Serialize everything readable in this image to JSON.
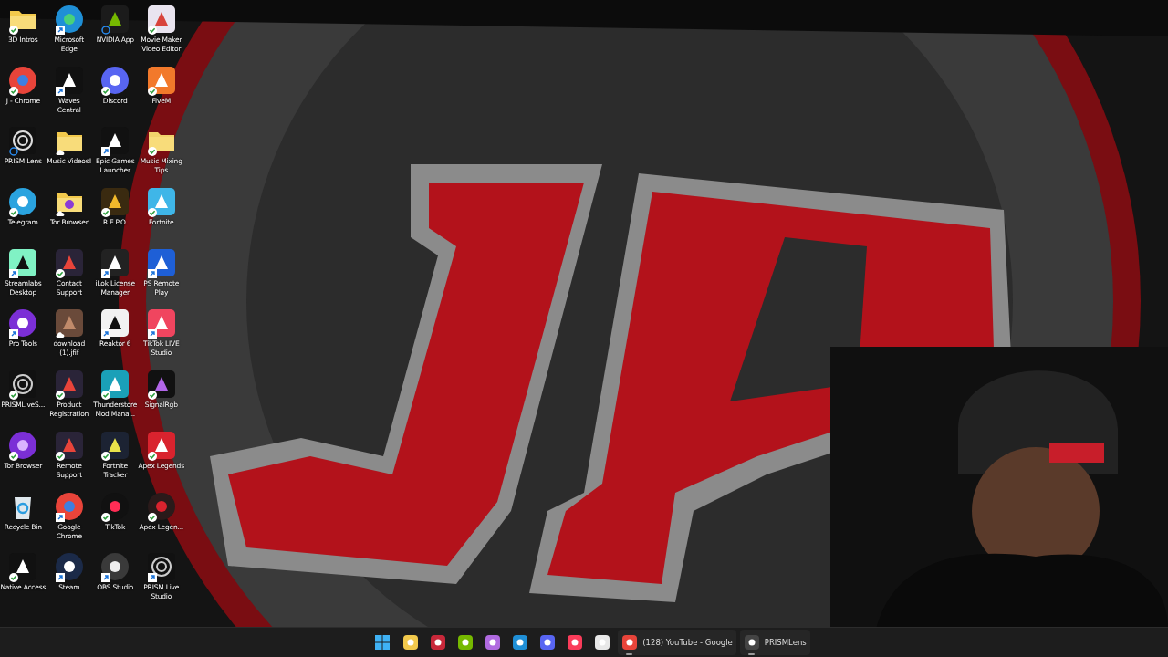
{
  "desktop_icons": [
    {
      "label": "3D Intros",
      "kind": "synced"
    },
    {
      "label": "Microsoft Edge",
      "kind": "shortcut"
    },
    {
      "label": "NVIDIA App",
      "kind": "syncing"
    },
    {
      "label": "Movie Maker Video Editor",
      "kind": "synced"
    },
    {
      "label": "J - Chrome",
      "kind": "synced"
    },
    {
      "label": "Waves Central",
      "kind": "shortcut"
    },
    {
      "label": "Discord",
      "kind": "synced"
    },
    {
      "label": "FiveM",
      "kind": "synced"
    },
    {
      "label": "PRISM Lens",
      "kind": "syncing"
    },
    {
      "label": "Music Videos!",
      "kind": "cloud"
    },
    {
      "label": "Epic Games Launcher",
      "kind": "shortcut"
    },
    {
      "label": "Music Mixing Tips",
      "kind": "synced"
    },
    {
      "label": "Telegram",
      "kind": "synced"
    },
    {
      "label": "Tor Browser",
      "kind": "cloud"
    },
    {
      "label": "R.E.P.O.",
      "kind": "synced"
    },
    {
      "label": "Fortnite",
      "kind": "synced"
    },
    {
      "label": "Streamlabs Desktop",
      "kind": "shortcut"
    },
    {
      "label": "Contact Support",
      "kind": "synced"
    },
    {
      "label": "iLok License Manager",
      "kind": "shortcut"
    },
    {
      "label": "PS Remote Play",
      "kind": "shortcut"
    },
    {
      "label": "Pro Tools",
      "kind": "shortcut"
    },
    {
      "label": "download (1).jfif",
      "kind": "cloud"
    },
    {
      "label": "Reaktor 6",
      "kind": "shortcut"
    },
    {
      "label": "TikTok LIVE Studio",
      "kind": "shortcut"
    },
    {
      "label": "PRISMLiveS...",
      "kind": "synced"
    },
    {
      "label": "Product Registration",
      "kind": "synced"
    },
    {
      "label": "Thunderstore Mod Mana...",
      "kind": "synced"
    },
    {
      "label": "SignalRgb",
      "kind": "synced"
    },
    {
      "label": "Tor Browser",
      "kind": "synced"
    },
    {
      "label": "Remote Support",
      "kind": "synced"
    },
    {
      "label": "Fortnite Tracker",
      "kind": "synced"
    },
    {
      "label": "Apex Legends",
      "kind": "synced"
    },
    {
      "label": "Recycle Bin",
      "kind": "plain"
    },
    {
      "label": "Google Chrome",
      "kind": "shortcut"
    },
    {
      "label": "TikTok",
      "kind": "synced"
    },
    {
      "label": "Apex Legen...",
      "kind": "synced"
    },
    {
      "label": "Native Access",
      "kind": "synced"
    },
    {
      "label": "Steam",
      "kind": "shortcut"
    },
    {
      "label": "OBS Studio",
      "kind": "shortcut"
    },
    {
      "label": "PRISM Live Studio",
      "kind": "shortcut"
    }
  ],
  "taskbar": {
    "items": [
      {
        "kind": "start",
        "running": false
      },
      {
        "kind": "app",
        "running": false
      },
      {
        "kind": "app",
        "running": false
      },
      {
        "kind": "app",
        "running": false
      },
      {
        "kind": "app",
        "running": false
      },
      {
        "kind": "app",
        "running": false
      },
      {
        "kind": "app",
        "running": false
      },
      {
        "kind": "app",
        "running": false
      },
      {
        "kind": "app",
        "running": false
      },
      {
        "kind": "app",
        "running": true,
        "label": "(128) YouTube - Google"
      },
      {
        "kind": "app",
        "running": true,
        "label": "PRISMLens"
      }
    ]
  }
}
